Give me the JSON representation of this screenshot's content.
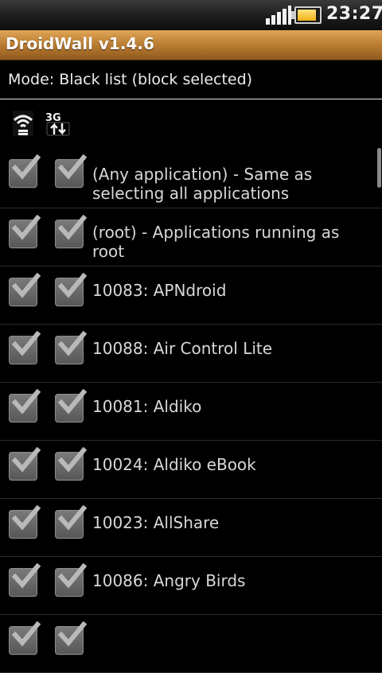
{
  "status_bar": {
    "time": "23:27",
    "signal_icon": "signal-bars-icon",
    "battery_icon": "battery-icon",
    "battery_level": 0.9
  },
  "app": {
    "title": "DroidWall v1.4.6",
    "title_bar_color": "#b5782f"
  },
  "mode": {
    "text": "Mode: Black list (block selected)"
  },
  "header_icons": {
    "wifi": "wifi-icon",
    "network_3g": "3g-data-icon",
    "network_3g_text": "3G"
  },
  "apps": [
    {
      "label": "(Any application) - Same as selecting all applications",
      "wifi": true,
      "g3": true
    },
    {
      "label": "(root) - Applications running as root",
      "wifi": true,
      "g3": true
    },
    {
      "label": "10083: APNdroid",
      "wifi": true,
      "g3": true
    },
    {
      "label": "10088: Air Control Lite",
      "wifi": true,
      "g3": true
    },
    {
      "label": "10081: Aldiko",
      "wifi": true,
      "g3": true
    },
    {
      "label": "10024: Aldiko eBook",
      "wifi": true,
      "g3": true
    },
    {
      "label": "10023: AllShare",
      "wifi": true,
      "g3": true
    },
    {
      "label": "10086: Angry Birds",
      "wifi": true,
      "g3": true
    },
    {
      "label": "",
      "wifi": true,
      "g3": true
    }
  ]
}
